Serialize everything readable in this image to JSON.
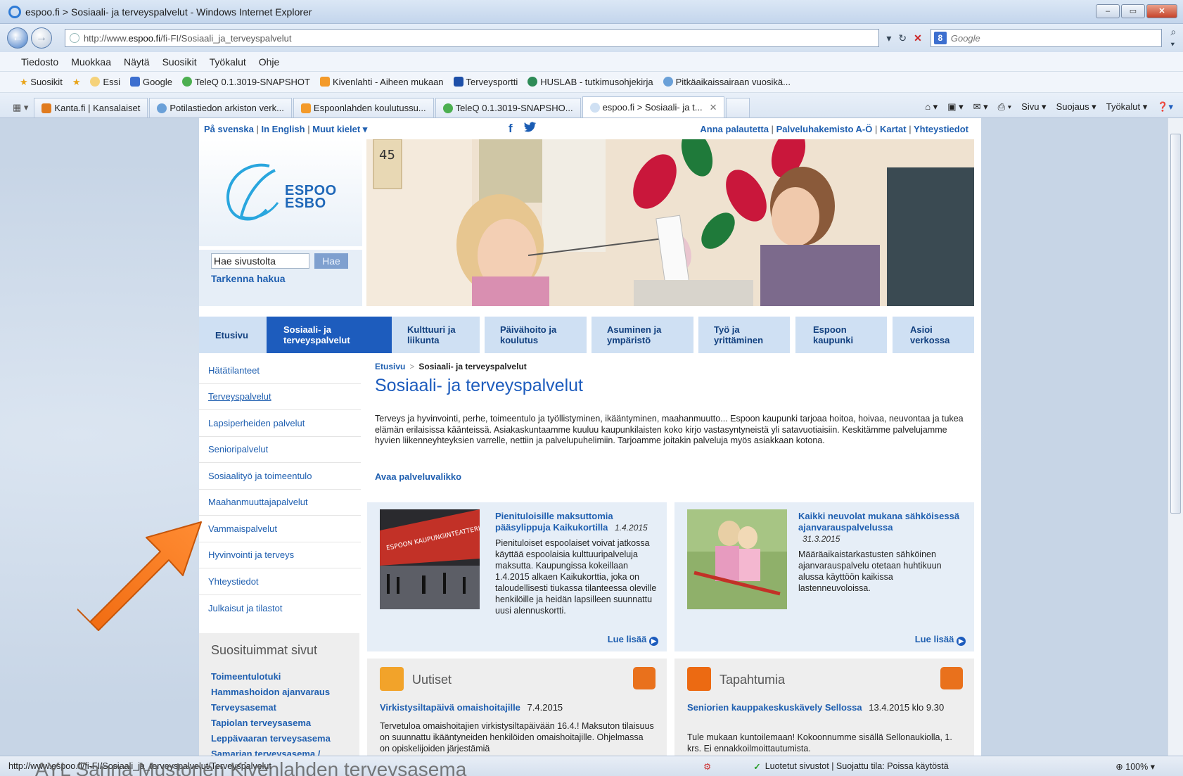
{
  "window": {
    "title": "espoo.fi > Sosiaali- ja terveyspalvelut - Windows Internet Explorer",
    "controls": [
      "‒",
      "▭",
      "✕"
    ]
  },
  "address": {
    "url_prefix": "http://www.",
    "url_domain": "espoo.fi",
    "url_path": "/fi-FI/Sosiaali_ja_terveyspalvelut",
    "search_placeholder": "Google"
  },
  "menu": [
    "Tiedosto",
    "Muokkaa",
    "Näytä",
    "Suosikit",
    "Työkalut",
    "Ohje"
  ],
  "favorites": {
    "label": "Suosikit",
    "items": [
      {
        "label": "Essi",
        "color": "#f5d27a"
      },
      {
        "label": "Google",
        "color": "#3d6fcf"
      },
      {
        "label": "TeleQ 0.1.3019-SNAPSHOT",
        "color": "#4caf50"
      },
      {
        "label": "Kivenlahti - Aiheen mukaan",
        "color": "#f39a2a"
      },
      {
        "label": "Terveysportti",
        "color": "#1d4fa8"
      },
      {
        "label": "HUSLAB - tutkimusohjekirja",
        "color": "#2e8b57"
      },
      {
        "label": "Pitkäaikaissairaan vuosikä...",
        "color": "#6aa0d8"
      }
    ]
  },
  "tabs": [
    {
      "label": "Kanta.fi | Kansalaiset",
      "active": false
    },
    {
      "label": "Potilastiedon arkiston verk...",
      "active": false
    },
    {
      "label": "Espoonlahden koulutussu...",
      "active": false
    },
    {
      "label": "TeleQ 0.1.3019-SNAPSHO...",
      "active": false
    },
    {
      "label": "espoo.fi > Sosiaali- ja t...",
      "active": true
    }
  ],
  "commandbar": [
    "Sivu ▾",
    "Suojaus ▾",
    "Työkalut ▾"
  ],
  "page": {
    "lang_links": [
      "På svenska",
      "In English",
      "Muut kielet ▾"
    ],
    "right_links": [
      "Anna palautetta",
      "Palveluhakemisto A-Ö",
      "Kartat",
      "Yhteystiedot"
    ],
    "logo": {
      "line1": "ESPOO",
      "line2": "ESBO"
    },
    "search": {
      "placeholder": "Hae sivustolta",
      "button": "Hae",
      "refine": "Tarkenna hakua"
    },
    "mainnav": [
      {
        "label": "Etusivu",
        "active": false
      },
      {
        "label": "Sosiaali- ja\nterveyspalvelut",
        "active": true
      },
      {
        "label": "Kulttuuri ja\nliikunta",
        "active": false
      },
      {
        "label": "Päivähoito ja\nkoulutus",
        "active": false
      },
      {
        "label": "Asuminen ja\nympäristö",
        "active": false
      },
      {
        "label": "Työ ja\nyrittäminen",
        "active": false
      },
      {
        "label": "Espoon\nkaupunki",
        "active": false
      },
      {
        "label": "Asioi\nverkossa",
        "active": false
      }
    ],
    "leftnav": [
      {
        "label": "Hätätilanteet",
        "current": false
      },
      {
        "label": "Terveyspalvelut",
        "current": true
      },
      {
        "label": "Lapsiperheiden palvelut",
        "current": false
      },
      {
        "label": "Senioripalvelut",
        "current": false
      },
      {
        "label": "Sosiaalityö ja toimeentulo",
        "current": false
      },
      {
        "label": "Maahanmuuttajapalvelut",
        "current": false
      },
      {
        "label": "Vammaispalvelut",
        "current": false
      },
      {
        "label": "Hyvinvointi ja terveys",
        "current": false
      },
      {
        "label": "Yhteystiedot",
        "current": false
      },
      {
        "label": "Julkaisut ja tilastot",
        "current": false
      }
    ],
    "popular": {
      "title": "Suosituimmat sivut",
      "links": [
        "Toimeentulotuki",
        "Hammashoidon ajanvaraus",
        "Terveysasemat",
        "Tapiolan terveysasema",
        "Leppävaaran terveysasema",
        "Samarian terveysasema /"
      ]
    },
    "breadcrumb": {
      "home": "Etusivu",
      "current": "Sosiaali- ja terveyspalvelut"
    },
    "title": "Sosiaali- ja terveyspalvelut",
    "intro": "Terveys ja hyvinvointi, perhe, toimeentulo ja työllistyminen, ikääntyminen, maahanmuutto... Espoon kaupunki tarjoaa hoitoa, hoivaa, neuvontaa ja tukea elämän erilaisissa käänteissä. Asiakaskuntaamme kuuluu kaupunkilaisten koko kirjo vastasyntyneistä yli satavuotiaisiin. Keskitämme palvelujamme hyvien liikenneyhteyksien varrelle, nettiin ja palvelupuhelimiin. Tarjoamme joitakin palveluja myös asiakkaan kotona.",
    "service_menu": "Avaa palveluvalikko",
    "news": [
      {
        "title": "Pienituloisille maksuttomia pääsylippuja Kaikukortilla",
        "date": "1.4.2015",
        "text": "Pienituloiset espoolaiset voivat jatkossa käyttää espoolaisia kulttuuripalveluja maksutta. Kaupungissa kokeillaan 1.4.2015 alkaen Kaikukorttia, joka on taloudellisesti tiukassa tilanteessa oleville henkilöille ja heidän lapsilleen suunnattu uusi alennuskortti.",
        "read_more": "Lue lisää"
      },
      {
        "title": "Kaikki neuvolat mukana sähköisessä ajanvarauspalvelussa",
        "date": "31.3.2015",
        "text": "Määräaikaistarkastusten sähköinen ajanvarauspalvelu otetaan huhtikuun alussa käyttöön kaikissa lastenneuvoloissa.",
        "read_more": "Lue lisää"
      }
    ],
    "feeds": [
      {
        "heading": "Uutiset",
        "link": "Virkistysiltapäivä omaishoitajille",
        "date": "7.4.2015",
        "text": "Tervetuloa omaishoitajien virkistysiltapäivään 16.4.! Maksuton tilaisuus on suunnattu ikääntyneiden henkilöiden omaishoitajille. Ohjelmassa on opiskelijoiden järjestämiä"
      },
      {
        "heading": "Tapahtumia",
        "link": "Seniorien kauppakeskuskävely Sellossa",
        "date": "13.4.2015 klo 9.30",
        "text": "Tule mukaan kuntoilemaan! Kokoonnumme sisällä Sellonaukiolla, 1. krs. Ei ennakkoilmoittautumista."
      }
    ]
  },
  "status": {
    "url": "http://www.espoo.fi/fi-FI/Sosiaali_ja_terveyspalvelut/Terveyspalvelut",
    "security": "Luotetut sivustot | Suojattu tila: Poissa käytöstä",
    "zoom": "100%"
  },
  "overlay_caption": "AYL Sanna Mustonen Kivenlahden terveysasema",
  "colors": {
    "accent": "#1d5cbd",
    "link": "#1f5fb0",
    "arrow": "#f26a10"
  }
}
